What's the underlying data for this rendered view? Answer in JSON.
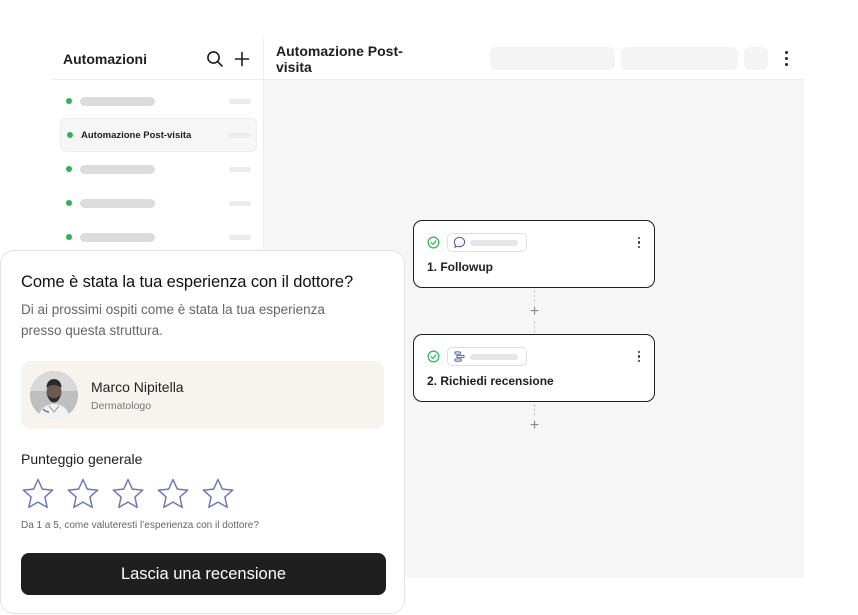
{
  "sidebar": {
    "title": "Automazioni",
    "active_item_label": "Automazione Post-visita",
    "status_color": "#2fb34f"
  },
  "header": {
    "title": "Automazione Post-visita"
  },
  "flow": {
    "steps": [
      {
        "label": "1. Followup",
        "icon": "chat-bubble-icon",
        "status": "check-circle-icon"
      },
      {
        "label": "2. Richiedi recensione",
        "icon": "list-form-icon",
        "status": "check-circle-icon"
      }
    ],
    "add_glyph": "+"
  },
  "review": {
    "title": "Come è stata la tua esperienza con il dottore?",
    "subtitle": "Di ai prossimi ospiti come è stata la tua esperienza presso questa struttura.",
    "doctor_name": "Marco Nipitella",
    "doctor_role": "Dermatologo",
    "rating_label": "Punteggio generale",
    "rating_value": 0,
    "rating_max": 5,
    "hint": "Da 1 a 5, come valuteresti l’esperienza con il dottore?",
    "submit_label": "Lascia una recensione",
    "star_color": "#6f78b8"
  }
}
